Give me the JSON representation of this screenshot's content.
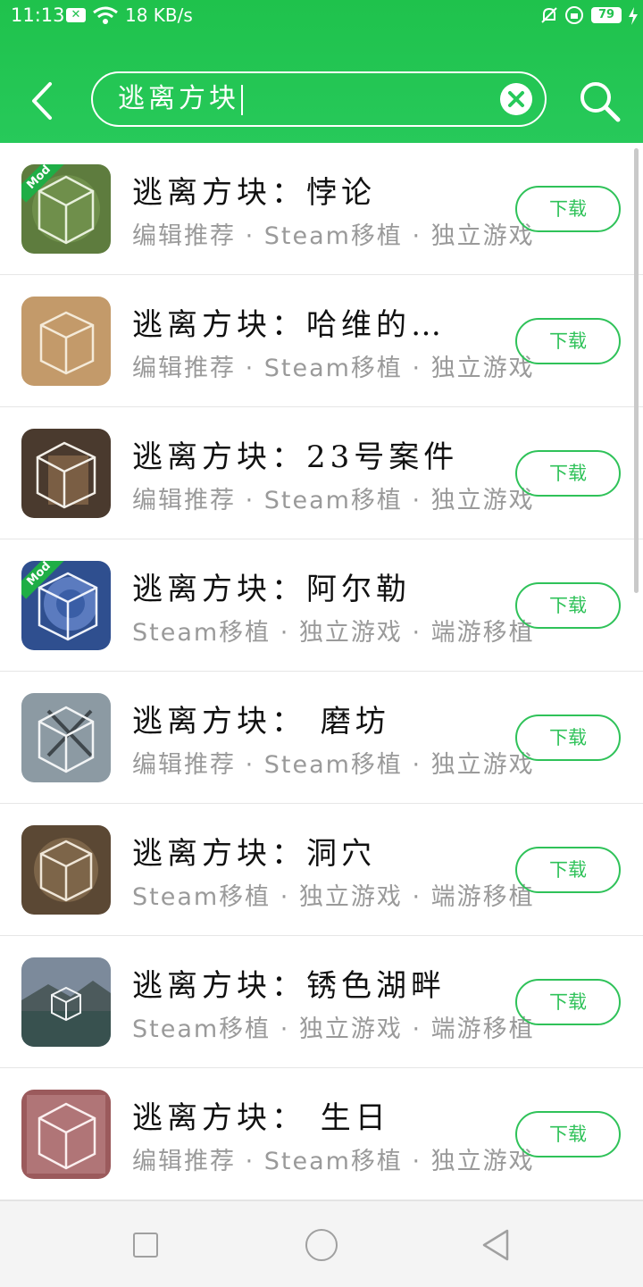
{
  "status_bar": {
    "time": "11:13",
    "speed": "18 KB/s",
    "battery": "79",
    "icons": [
      "x-icon",
      "wifi-icon",
      "bell-off-icon",
      "lock-rotation-icon",
      "battery-icon",
      "charging-icon"
    ]
  },
  "search": {
    "query": "逃离方块"
  },
  "colors": {
    "accent": "#27c95a",
    "button": "#2fc259"
  },
  "apps": [
    {
      "title": "逃离方块：悖论",
      "tags": "编辑推荐 · Steam移植 · 独立游戏",
      "mod": "Mod",
      "button": "下载"
    },
    {
      "title": "逃离方块：哈维的…",
      "tags": "编辑推荐 · Steam移植 · 独立游戏",
      "button": "下载"
    },
    {
      "title": "逃离方块：23号案件",
      "tags": "编辑推荐 · Steam移植 · 独立游戏",
      "button": "下载"
    },
    {
      "title": "逃离方块：阿尔勒",
      "tags": "Steam移植 · 独立游戏 · 端游移植",
      "mod": "Mod",
      "button": "下载"
    },
    {
      "title": "逃离方块： 磨坊",
      "tags": "编辑推荐 · Steam移植 · 独立游戏",
      "button": "下载"
    },
    {
      "title": "逃离方块：洞穴",
      "tags": "Steam移植 · 独立游戏 · 端游移植",
      "button": "下载"
    },
    {
      "title": "逃离方块：锈色湖畔",
      "tags": "Steam移植 · 独立游戏 · 端游移植",
      "button": "下载"
    },
    {
      "title": "逃离方块： 生日",
      "tags": "编辑推荐 · Steam移植 · 独立游戏",
      "button": "下载"
    }
  ]
}
